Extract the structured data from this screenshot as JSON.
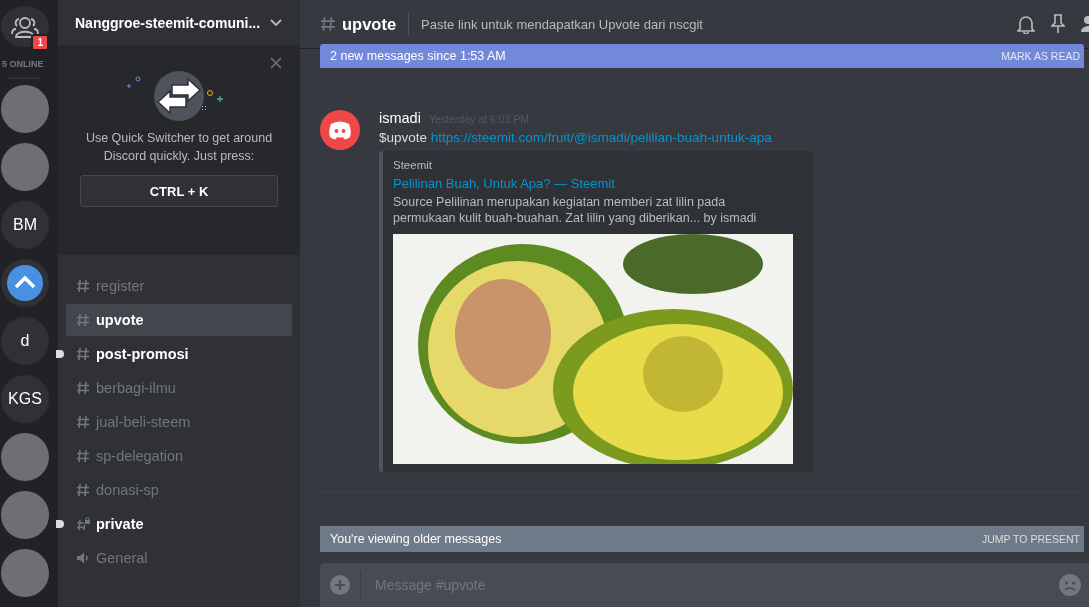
{
  "guild_rail": {
    "friends": {
      "badge": "1",
      "online": "5 ONLINE"
    },
    "servers": [
      {
        "kind": "image"
      },
      {
        "kind": "image"
      },
      {
        "kind": "text",
        "label": "BM"
      },
      {
        "kind": "chevron"
      },
      {
        "kind": "text",
        "label": "d"
      },
      {
        "kind": "text",
        "label": "KGS"
      },
      {
        "kind": "image"
      },
      {
        "kind": "image"
      },
      {
        "kind": "image"
      }
    ]
  },
  "sidebar": {
    "server_name": "Nanggroe-steemit-comuni...",
    "quick_switcher": {
      "text": "Use Quick Switcher to get around Discord quickly. Just press:",
      "shortcut": "CTRL + K"
    },
    "channels": [
      {
        "kind": "text",
        "name": "register",
        "selected": false,
        "unread": false
      },
      {
        "kind": "text",
        "name": "upvote",
        "selected": true,
        "unread": false
      },
      {
        "kind": "text",
        "name": "post-promosi",
        "selected": false,
        "unread": true
      },
      {
        "kind": "text",
        "name": "berbagi-ilmu",
        "selected": false,
        "unread": false
      },
      {
        "kind": "text",
        "name": "jual-beli-steem",
        "selected": false,
        "unread": false
      },
      {
        "kind": "text",
        "name": "sp-delegation",
        "selected": false,
        "unread": false
      },
      {
        "kind": "text",
        "name": "donasi-sp",
        "selected": false,
        "unread": false
      },
      {
        "kind": "private",
        "name": "private",
        "selected": false,
        "unread": true
      },
      {
        "kind": "voice",
        "name": "General",
        "selected": false,
        "unread": false
      }
    ]
  },
  "header": {
    "channel": "upvote",
    "topic": "Paste link untuk mendapatkan Upvote dari nscgit"
  },
  "new_messages_bar": {
    "text": "2 new messages since 1:53 AM",
    "action": "MARK AS READ"
  },
  "message": {
    "author": "ismadi",
    "time": "Yesterday at 6:03 PM",
    "command": "$upvote",
    "link": "https://steemit.com/fruit/@ismadi/pelilian-buah-untuk-apa",
    "embed": {
      "provider": "Steemit",
      "title": "Pelilinan Buah, Untuk Apa? — Steemit",
      "description": "Source Pelilinan merupakan kegiatan memberi zat lilin pada permukaan kulit buah-buahan. Zat lilin yang diberikan... by ismadi"
    }
  },
  "older_messages_bar": {
    "text": "You're viewing older messages",
    "action": "JUMP TO PRESENT"
  },
  "composer": {
    "placeholder": "Message #upvote"
  }
}
